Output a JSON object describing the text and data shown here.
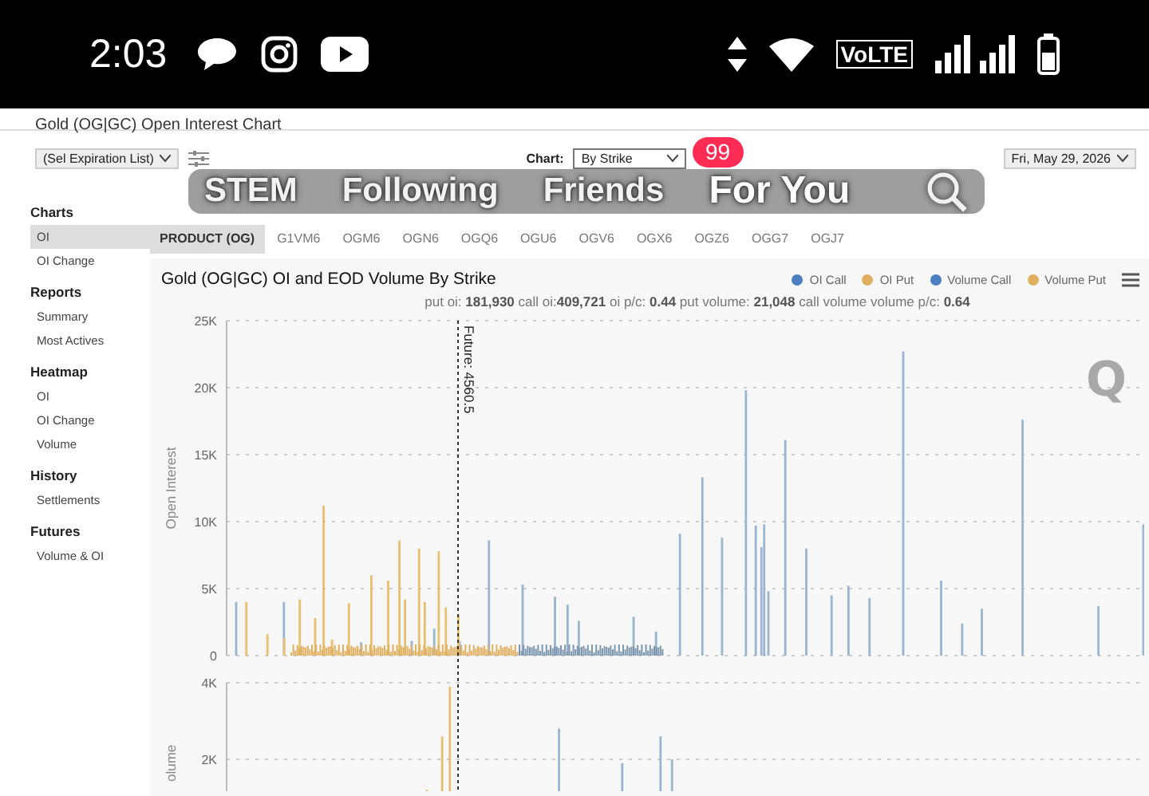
{
  "status_bar": {
    "time": "2:03",
    "network": "VoLTE"
  },
  "page": {
    "title": "Gold (OG|GC) Open Interest Chart",
    "expiration_select": "(Sel Expiration List)",
    "chart_label": "Chart:",
    "chart_select": "By Strike",
    "date_select": "Fri, May 29, 2026"
  },
  "sidebar": [
    {
      "heading": "Charts",
      "items": [
        {
          "label": "OI",
          "selected": true
        },
        {
          "label": "OI Change",
          "selected": false
        }
      ]
    },
    {
      "heading": "Reports",
      "items": [
        {
          "label": "Summary",
          "selected": false
        },
        {
          "label": "Most Actives",
          "selected": false
        }
      ]
    },
    {
      "heading": "Heatmap",
      "items": [
        {
          "label": "OI",
          "selected": false
        },
        {
          "label": "OI Change",
          "selected": false
        },
        {
          "label": "Volume",
          "selected": false
        }
      ]
    },
    {
      "heading": "History",
      "items": [
        {
          "label": "Settlements",
          "selected": false
        }
      ]
    },
    {
      "heading": "Futures",
      "items": [
        {
          "label": "Volume & OI",
          "selected": false
        }
      ]
    }
  ],
  "tabs": [
    {
      "label": "PRODUCT (OG)",
      "selected": true
    },
    {
      "label": "G1VM6",
      "selected": false
    },
    {
      "label": "OGM6",
      "selected": false
    },
    {
      "label": "OGN6",
      "selected": false
    },
    {
      "label": "OGQ6",
      "selected": false
    },
    {
      "label": "OGU6",
      "selected": false
    },
    {
      "label": "OGV6",
      "selected": false
    },
    {
      "label": "OGX6",
      "selected": false
    },
    {
      "label": "OGZ6",
      "selected": false
    },
    {
      "label": "OGG7",
      "selected": false
    },
    {
      "label": "OGJ7",
      "selected": false
    }
  ],
  "chart": {
    "title": "Gold (OG|GC) OI and EOD Volume By Strike",
    "legend": [
      {
        "label": "OI Call",
        "color": "#4a7fc1"
      },
      {
        "label": "OI Put",
        "color": "#e0b060"
      },
      {
        "label": "Volume Call",
        "color": "#4a7fc1"
      },
      {
        "label": "Volume Put",
        "color": "#e0b060"
      }
    ],
    "stats": "put oi: **181,930** call oi:**409,721** oi p/c: **0.44** put volume: **21,048** call volume volume p/c: **0.64**",
    "oi_axis": "Open Interest",
    "oi_ticks": [
      "25K",
      "20K",
      "15K",
      "10K",
      "5K",
      "0"
    ],
    "future_label": "Future: 4560.5",
    "logo": "Q",
    "volume_axis": "olume",
    "volume_ticks": [
      "4K",
      "2K"
    ]
  },
  "overlay": {
    "badge": "99",
    "tabs": [
      {
        "label": "STEM",
        "selected": false
      },
      {
        "label": "Following",
        "selected": false
      },
      {
        "label": "Friends",
        "selected": false
      },
      {
        "label": "For You",
        "selected": true
      }
    ]
  }
}
